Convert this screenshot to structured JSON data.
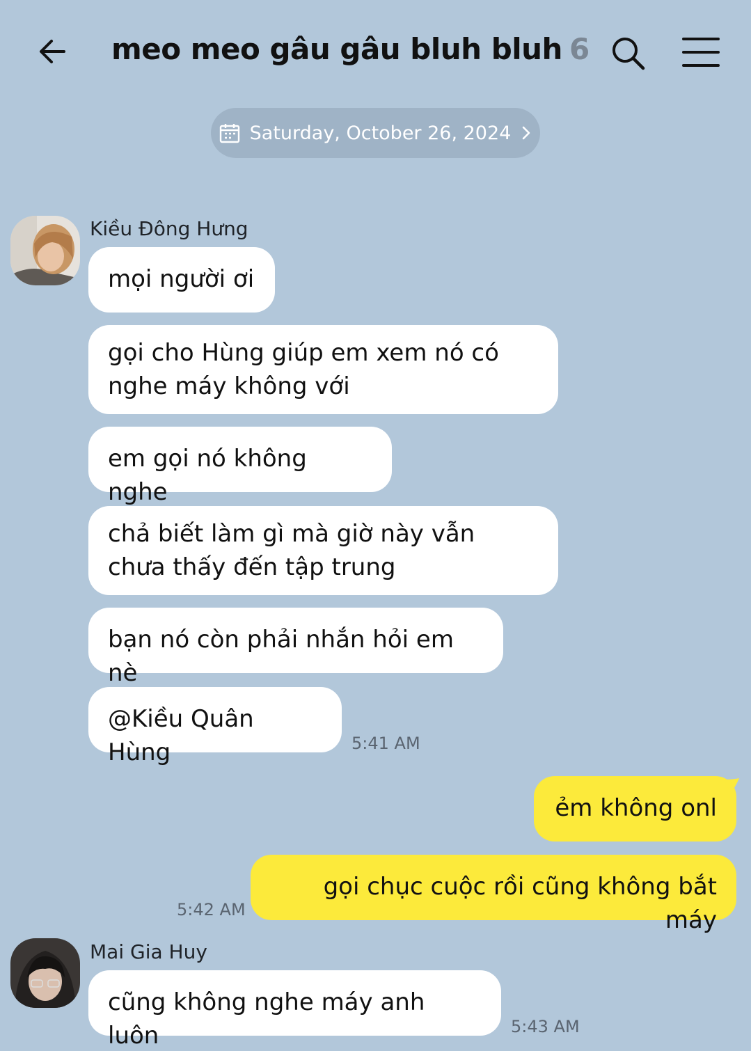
{
  "header": {
    "title": "meo meo gâu gâu bluh bluh",
    "member_count": "6",
    "icons": [
      "back-arrow-icon",
      "search-icon",
      "menu-icon"
    ]
  },
  "date_divider": {
    "label": "Saturday, October 26, 2024",
    "icon": "calendar-icon"
  },
  "colors": {
    "background": "#b2c7da",
    "incoming_bubble": "#ffffff",
    "outgoing_bubble": "#fcea3b",
    "date_pill": "#9fb3c6"
  },
  "messages": {
    "group1": {
      "sender": "Kiều Đông Hưng",
      "texts": [
        "mọi người ơi",
        "gọi cho Hùng giúp em xem nó có nghe máy không với",
        "em gọi nó không nghe",
        "chả biết làm gì mà giờ này vẫn chưa thấy đến tập trung",
        "bạn nó còn phải nhắn hỏi em nè",
        "@Kiều Quân Hùng"
      ],
      "time": "5:41 AM"
    },
    "group2": {
      "sender": "me",
      "texts": [
        "ẻm không onl",
        "gọi chục cuộc rồi cũng không bắt máy"
      ],
      "time": "5:42 AM"
    },
    "group3": {
      "sender": "Mai Gia Huy",
      "texts": [
        "cũng không nghe máy anh luôn"
      ],
      "time": "5:43 AM"
    }
  }
}
